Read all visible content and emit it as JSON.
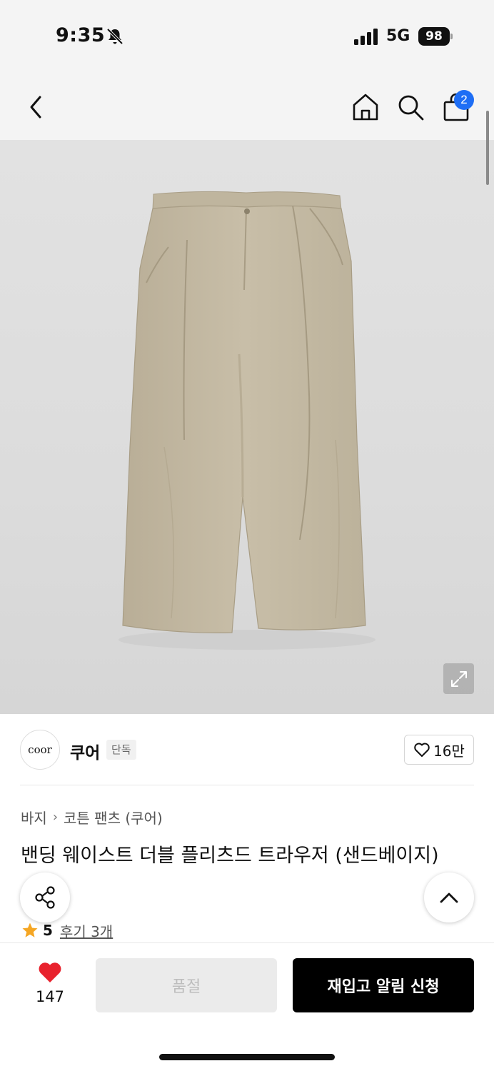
{
  "status_bar": {
    "time": "9:35",
    "network": "5G",
    "battery": "98"
  },
  "nav": {
    "cart_count": "2"
  },
  "brand": {
    "logo_text": "coor",
    "name": "쿠어",
    "tag": "단독",
    "likes": "16만"
  },
  "breadcrumb": {
    "category": "바지",
    "subcategory": "코튼 팬츠 (쿠어)"
  },
  "product": {
    "title": "밴딩 웨이스트 더블 플리츠드 트라우저 (샌드베이지)"
  },
  "rating": {
    "score": "5",
    "reviews_label": "후기 3개"
  },
  "bottom": {
    "wish_count": "147",
    "soldout_label": "품절",
    "restock_label": "재입고 알림 신청"
  },
  "colors": {
    "accent": "#1e6ef5",
    "heart": "#e8222d",
    "star": "#f5a623",
    "pants": "#c4baa4"
  }
}
